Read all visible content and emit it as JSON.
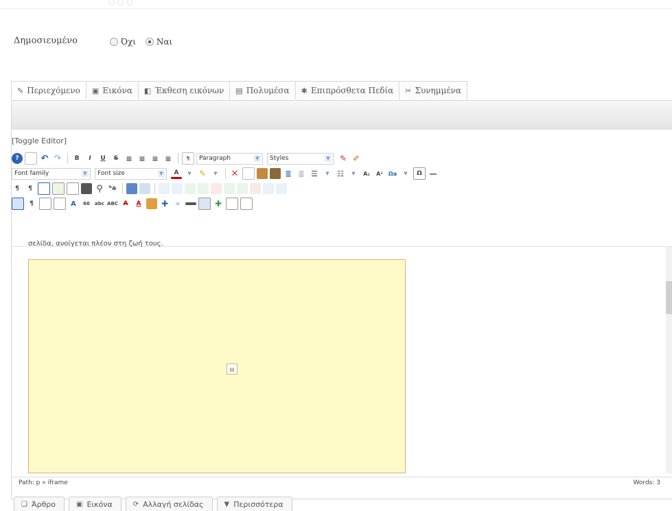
{
  "form": {
    "published_label": "Δημοσιευμένο",
    "published_options": [
      {
        "label": "Όχι",
        "checked": false
      },
      {
        "label": "Ναι",
        "checked": true
      }
    ]
  },
  "tabs": [
    {
      "label": "Περιεχόμενο",
      "icon": "edit-icon",
      "glyph": "✎"
    },
    {
      "label": "Εικόνα",
      "icon": "image-icon",
      "glyph": "▣"
    },
    {
      "label": "Έκθεση εικόνων",
      "icon": "gallery-icon",
      "glyph": "◧"
    },
    {
      "label": "Πολυμέσα",
      "icon": "media-icon",
      "glyph": "▤"
    },
    {
      "label": "Επιπρόσθετα Πεδία",
      "icon": "fields-icon",
      "glyph": "✱"
    },
    {
      "label": "Συνημμένα",
      "icon": "paperclip-icon",
      "glyph": "✂"
    }
  ],
  "editor": {
    "toggle_label": "[Toggle Editor]",
    "format_select": "Paragraph",
    "styles_select": "Styles",
    "font_family_select": "Font family",
    "font_size_select": "Font size",
    "content_text": "σελίδα, ανοίγεται πλέον στη ζωή τους.",
    "path_label": "Path: p » iframe",
    "word_count": "Words: 3",
    "accent_color": "#fffbc8",
    "border_color": "#e9a97a"
  },
  "bottom_buttons": [
    {
      "label": "Άρθρο",
      "icon": "article-icon",
      "glyph": "❏"
    },
    {
      "label": "Εικόνα",
      "icon": "image-icon",
      "glyph": "▣"
    },
    {
      "label": "Αλλαγή σελίδας",
      "icon": "page-break-icon",
      "glyph": "⟳"
    },
    {
      "label": "Περισσότερα",
      "icon": "chevron-down-icon",
      "glyph": "▼"
    }
  ]
}
